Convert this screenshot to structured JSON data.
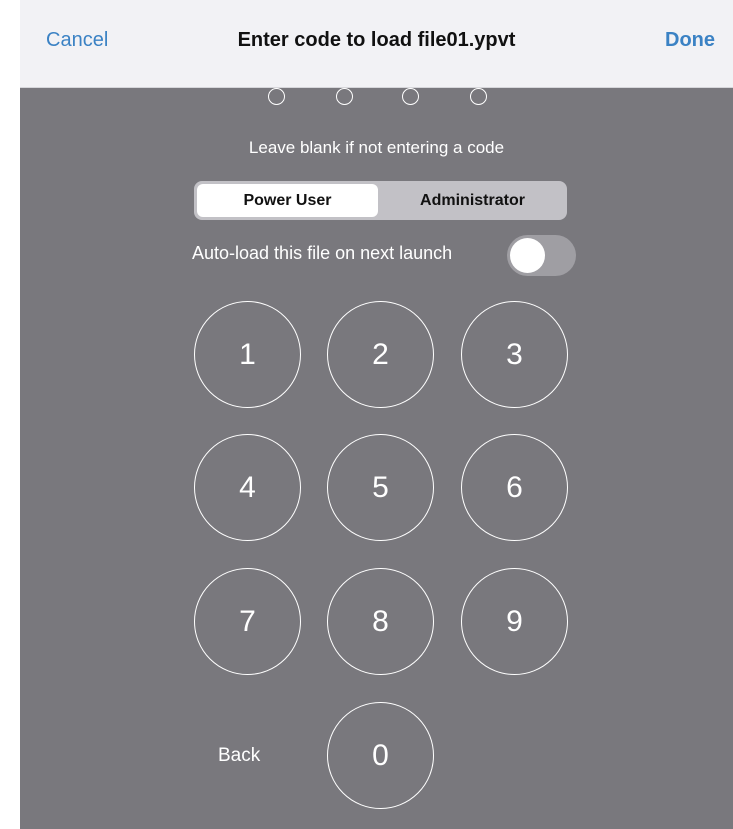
{
  "navbar": {
    "cancel_label": "Cancel",
    "title": "Enter code to load file01.ypvt",
    "done_label": "Done"
  },
  "passcode": {
    "digits_entered": 0,
    "digits_total": 4
  },
  "hint": "Leave blank if not entering a code",
  "role_selector": {
    "options": [
      "Power User",
      "Administrator"
    ],
    "selected": "Power User"
  },
  "autoload": {
    "label": "Auto-load this file on next launch",
    "enabled": false
  },
  "keypad": {
    "keys": [
      "1",
      "2",
      "3",
      "4",
      "5",
      "6",
      "7",
      "8",
      "9",
      "0"
    ],
    "back_label": "Back"
  },
  "colors": {
    "accent": "#3b82c4",
    "panel": "#79787d",
    "navbar": "#f2f2f5"
  }
}
